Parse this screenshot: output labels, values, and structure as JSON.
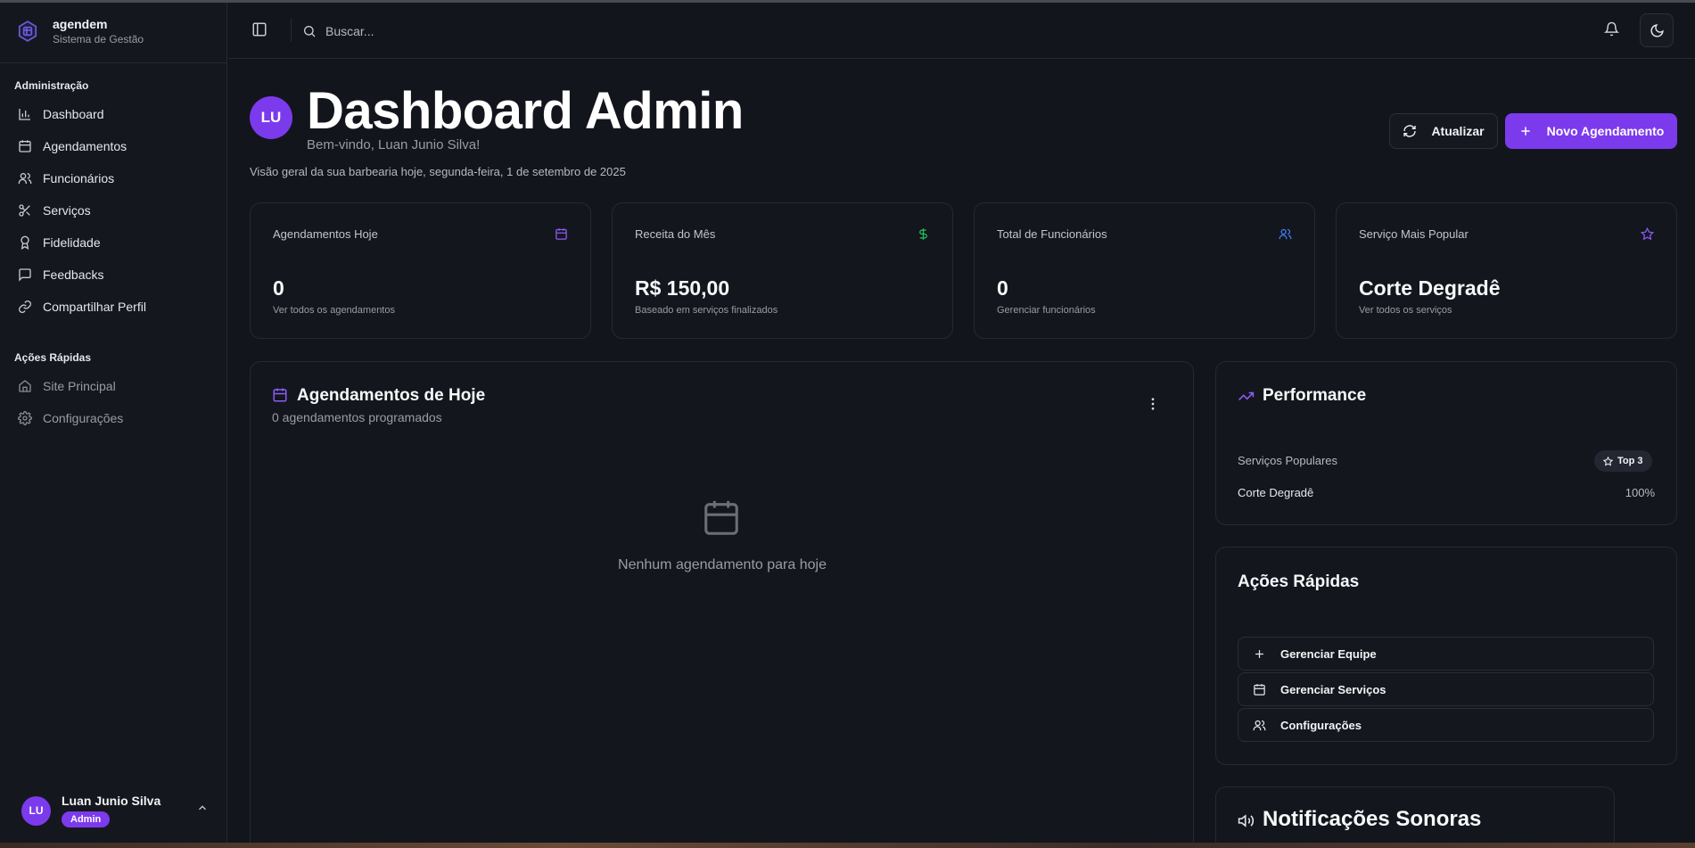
{
  "brand": {
    "name": "agendem",
    "subtitle": "Sistema de Gestão"
  },
  "sidebar": {
    "admin_label": "Administração",
    "admin_items": [
      {
        "label": "Dashboard",
        "icon": "bar-chart-icon"
      },
      {
        "label": "Agendamentos",
        "icon": "calendar-icon"
      },
      {
        "label": "Funcionários",
        "icon": "users-icon"
      },
      {
        "label": "Serviços",
        "icon": "scissors-icon"
      },
      {
        "label": "Fidelidade",
        "icon": "award-icon"
      },
      {
        "label": "Feedbacks",
        "icon": "message-icon"
      },
      {
        "label": "Compartilhar Perfil",
        "icon": "link-icon"
      }
    ],
    "quick_label": "Ações Rápidas",
    "quick_items": [
      {
        "label": "Site Principal",
        "icon": "home-icon"
      },
      {
        "label": "Configurações",
        "icon": "gear-icon"
      }
    ],
    "user": {
      "initials": "LU",
      "name": "Luan Junio Silva",
      "role": "Admin"
    }
  },
  "header": {
    "search_placeholder": "Buscar..."
  },
  "hero": {
    "avatar_initials": "LU",
    "title": "Dashboard Admin",
    "welcome": "Bem-vindo, Luan Junio Silva!",
    "overview": "Visão geral da sua barbearia hoje, segunda-feira, 1 de setembro de 2025",
    "refresh_label": "Atualizar",
    "new_label": "Novo Agendamento"
  },
  "stats": [
    {
      "label": "Agendamentos Hoje",
      "value": "0",
      "sub": "Ver todos os agendamentos",
      "icon": "calendar-icon",
      "color": "#8b5cf6"
    },
    {
      "label": "Receita do Mês",
      "value": "R$ 150,00",
      "sub": "Baseado em serviços finalizados",
      "icon": "dollar-icon",
      "color": "#22c55e"
    },
    {
      "label": "Total de Funcionários",
      "value": "0",
      "sub": "Gerenciar funcionários",
      "icon": "users-icon",
      "color": "#3b82f6"
    },
    {
      "label": "Serviço Mais Popular",
      "value": "Corte Degradê",
      "sub": "Ver todos os serviços",
      "icon": "star-icon",
      "color": "#8b5cf6"
    }
  ],
  "today": {
    "title": "Agendamentos de Hoje",
    "subtitle": "0 agendamentos programados",
    "empty_text": "Nenhum agendamento para hoje"
  },
  "performance": {
    "title": "Performance",
    "popular_label": "Serviços Populares",
    "badge": "Top 3",
    "items": [
      {
        "name": "Corte Degradê",
        "percent": "100%"
      }
    ]
  },
  "quick_actions": {
    "title": "Ações Rápidas",
    "buttons": [
      {
        "label": "Gerenciar Equipe",
        "icon": "plus-icon"
      },
      {
        "label": "Gerenciar Serviços",
        "icon": "calendar-icon"
      },
      {
        "label": "Configurações",
        "icon": "users-icon"
      }
    ]
  },
  "notifications": {
    "title": "Notificações Sonoras"
  },
  "colors": {
    "accent": "#7c3aed",
    "background": "#13151c",
    "card": "#14161d",
    "border": "#262932"
  }
}
